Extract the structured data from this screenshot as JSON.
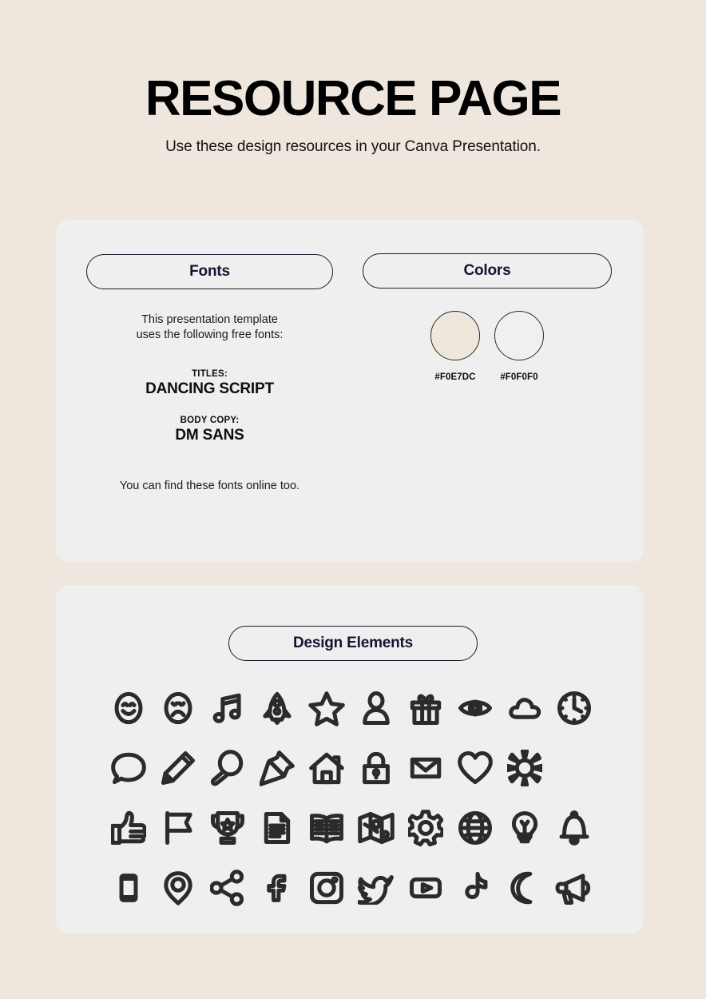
{
  "header": {
    "title": "RESOURCE PAGE",
    "subtitle": "Use these design resources in your Canva Presentation."
  },
  "resources_card": {
    "fonts": {
      "heading": "Fonts",
      "intro": "This presentation template\nuses the following free fonts:",
      "groups": [
        {
          "label": "TITLES:",
          "name": "DANCING SCRIPT"
        },
        {
          "label": "BODY COPY:",
          "name": "DM SANS"
        }
      ],
      "footnote": "You can find these fonts online too."
    },
    "colors": {
      "heading": "Colors",
      "swatches": [
        {
          "hex": "#F0E7DC",
          "label": "#F0E7DC"
        },
        {
          "hex": "#F0F0F0",
          "label": "#F0F0F0"
        }
      ]
    }
  },
  "elements_card": {
    "heading": "Design Elements",
    "rows": [
      [
        "smiley-face-icon",
        "sad-face-icon",
        "music-note-icon",
        "rocket-icon",
        "star-icon",
        "person-icon",
        "gift-icon",
        "eye-icon",
        "cloud-icon",
        "clock-icon"
      ],
      [
        "speech-bubble-icon",
        "pencil-icon",
        "magnifying-glass-icon",
        "pushpin-icon",
        "house-icon",
        "lock-icon",
        "envelope-icon",
        "heart-icon",
        "sun-icon"
      ],
      [
        "thumbs-up-icon",
        "flag-icon",
        "trophy-icon",
        "document-icon",
        "book-icon",
        "map-icon",
        "gear-icon",
        "globe-icon",
        "lightbulb-icon",
        "bell-icon"
      ],
      [
        "phone-icon",
        "location-pin-icon",
        "share-icon",
        "facebook-icon",
        "instagram-icon",
        "twitter-icon",
        "youtube-icon",
        "tiktok-icon",
        "moon-icon",
        "megaphone-icon"
      ]
    ]
  },
  "theme": {
    "background": "#EFE7DD",
    "card_background": "#EFEFEF",
    "ink": "#131432"
  }
}
